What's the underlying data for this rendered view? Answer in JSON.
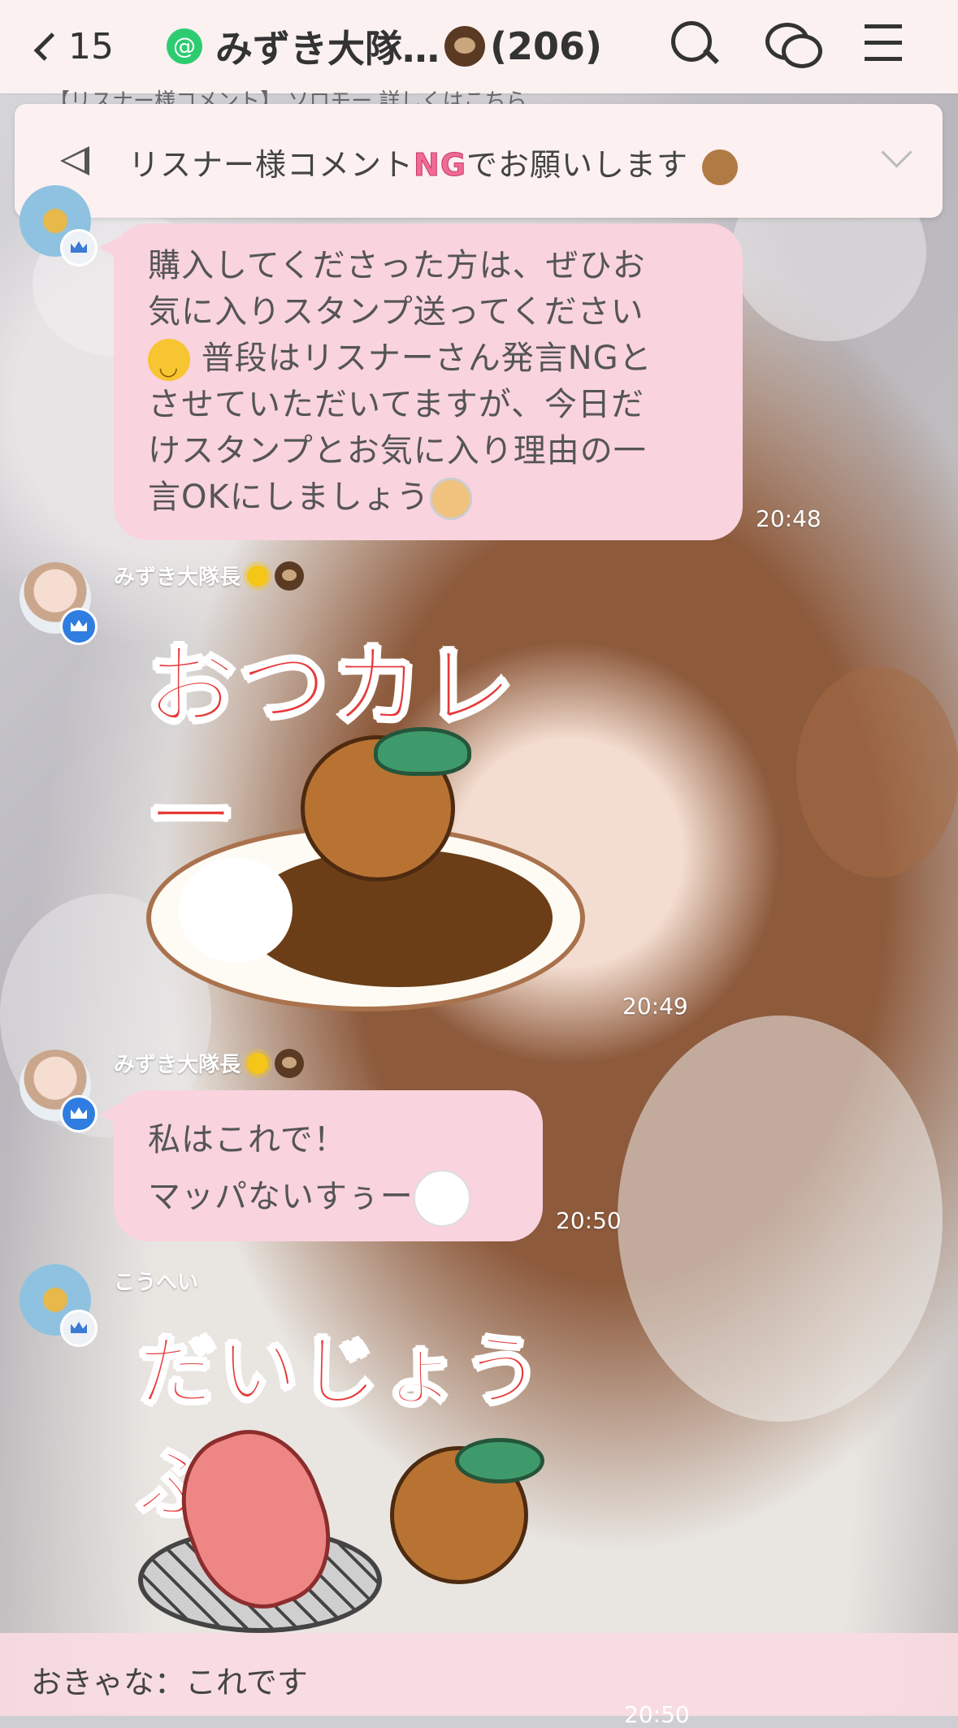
{
  "header": {
    "back_count": "15",
    "official_badge": "@",
    "chat_name": "みずき大隊…",
    "member_count": "(206)"
  },
  "peek_text": "【リスナー様コメント】 ソロモー 詳しくはこちら",
  "notice": {
    "text_before": "リスナー様コメント",
    "text_ng": "NG",
    "text_after": "でお願いします"
  },
  "messages": [
    {
      "text_lines": [
        "購入してくださった方は、ぜひお",
        "気に入りスタンプ送ってください",
        "普段はリスナーさん発言NGと",
        "させていただいてますが、今日だ",
        "けスタンプとお気に入り理由の一",
        "言OKにしましょう"
      ],
      "time": "20:48"
    },
    {
      "sender": "みずき大隊長",
      "sticker_text": "おつカレー",
      "time": "20:49"
    },
    {
      "sender": "みずき大隊長",
      "text_lines": [
        "私はこれで！",
        "マッパないすぅー"
      ],
      "time": "20:50"
    },
    {
      "sender": "こうへい",
      "sticker_text": "だいじょうぶ？"
    }
  ],
  "preview": {
    "text": "おきゃな：これです",
    "time": "20:50"
  },
  "colors": {
    "header_bg": "#fbf1f1",
    "bubble": "#f9d3de",
    "badge_blue": "#2f7de1",
    "sticker_red": "#e53a3a"
  }
}
